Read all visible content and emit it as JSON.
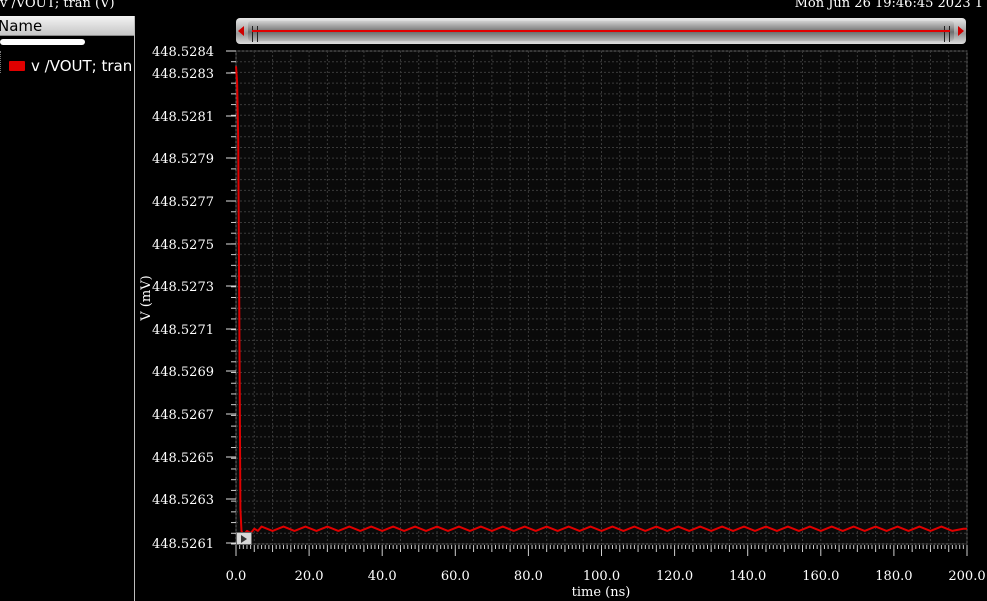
{
  "window": {
    "title": "v /VOUT; tran (V)",
    "timestamp": "Mon Jun 26 19:46:45 2023  1"
  },
  "legend": {
    "header": "Name",
    "items": [
      {
        "label": "v /VOUT; tran",
        "color": "#e00000"
      }
    ]
  },
  "chart_data": {
    "type": "line",
    "title": "",
    "xlabel": "time (ns)",
    "ylabel": "V (mV)",
    "xlim": [
      0,
      200
    ],
    "ylim": [
      448.52614,
      448.5284
    ],
    "grid": true,
    "xticks": [
      "0.0",
      "20.0",
      "40.0",
      "60.0",
      "80.0",
      "100.0",
      "120.0",
      "140.0",
      "160.0",
      "180.0",
      "200.0"
    ],
    "yticks": [
      "448.5284",
      "448.5283",
      "448.5281",
      "448.5279",
      "448.5277",
      "448.5275",
      "448.5273",
      "448.5271",
      "448.5269",
      "448.5267",
      "448.5265",
      "448.5263",
      "448.5261"
    ],
    "series": [
      {
        "name": "v /VOUT; tran",
        "color": "#e00000",
        "x": [
          0,
          0.3,
          0.6,
          0.9,
          1.2,
          1.5,
          2.0,
          3.0,
          4.0,
          5.0,
          6.0,
          7.0,
          10.0,
          13.0,
          16.0,
          19.0,
          22.0,
          25.0,
          28.0,
          31.0,
          34.0,
          37.0,
          40.0,
          43.0,
          46.0,
          49.0,
          52.0,
          55.0,
          58.0,
          61.0,
          64.0,
          67.0,
          70.0,
          73.0,
          76.0,
          79.0,
          82.0,
          85.0,
          88.0,
          91.0,
          94.0,
          97.0,
          100.0,
          103.0,
          106.0,
          109.0,
          112.0,
          115.0,
          118.0,
          121.0,
          124.0,
          127.0,
          130.0,
          133.0,
          136.0,
          139.0,
          142.0,
          145.0,
          148.0,
          151.0,
          154.0,
          157.0,
          160.0,
          163.0,
          166.0,
          169.0,
          172.0,
          175.0,
          178.0,
          181.0,
          184.0,
          187.0,
          190.0,
          193.0,
          196.0,
          199.0,
          200.0
        ],
        "y": [
          448.52833,
          448.52826,
          448.528,
          448.5272,
          448.5263,
          448.5262,
          448.52618,
          448.5262,
          448.52619,
          448.52621,
          448.5262,
          448.52622,
          448.5262,
          448.52622,
          448.5262,
          448.52622,
          448.5262,
          448.52622,
          448.5262,
          448.52622,
          448.5262,
          448.52622,
          448.5262,
          448.52622,
          448.5262,
          448.52622,
          448.5262,
          448.52622,
          448.5262,
          448.52622,
          448.5262,
          448.52622,
          448.5262,
          448.52622,
          448.5262,
          448.52622,
          448.5262,
          448.52622,
          448.5262,
          448.52622,
          448.5262,
          448.52622,
          448.5262,
          448.52622,
          448.5262,
          448.52622,
          448.5262,
          448.52622,
          448.5262,
          448.52622,
          448.5262,
          448.52622,
          448.5262,
          448.52622,
          448.5262,
          448.52622,
          448.5262,
          448.52622,
          448.5262,
          448.52622,
          448.5262,
          448.52622,
          448.5262,
          448.52622,
          448.5262,
          448.52622,
          448.5262,
          448.52622,
          448.5262,
          448.52622,
          448.5262,
          448.52622,
          448.5262,
          448.52622,
          448.5262,
          448.52621,
          448.52621
        ]
      }
    ]
  }
}
